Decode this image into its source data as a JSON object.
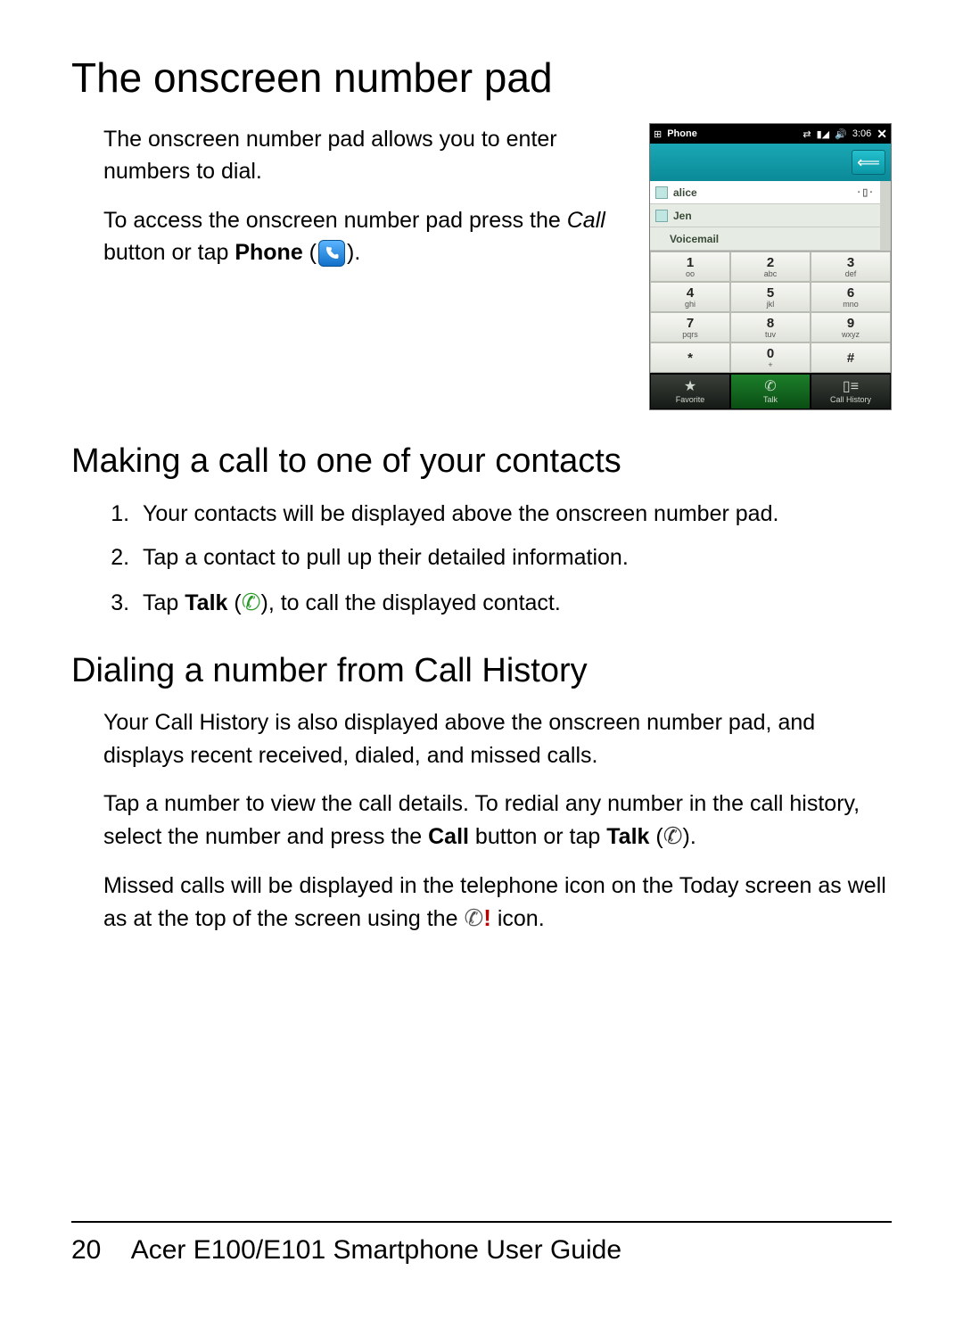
{
  "page": {
    "title": "The onscreen number pad",
    "intro1": "The onscreen number pad allows you to enter numbers to dial.",
    "intro2a": "To access the onscreen number pad press the ",
    "intro2b": "Call",
    "intro2c": " button or tap ",
    "intro2d": "Phone",
    "intro2e": " (",
    "intro2f": ")."
  },
  "section2": {
    "title": "Making a call to one of your contacts",
    "items": [
      "Your contacts will be displayed above the onscreen number pad.",
      "Tap a contact to pull up their detailed information."
    ],
    "item3a": "Tap ",
    "item3b": "Talk",
    "item3c": " (",
    "item3d": "), to call the displayed contact."
  },
  "section3": {
    "title": "Dialing a number from Call History",
    "p1": "Your Call History is also displayed above the onscreen number pad, and displays recent received, dialed, and missed calls.",
    "p2a": "Tap a number to view the call details. To redial any number in the call history, select the number and press the ",
    "p2b": "Call",
    "p2c": " button or tap ",
    "p2d": "Talk",
    "p2e": " (",
    "p2f": ").",
    "p3a": "Missed calls will be displayed in the telephone icon on the Today screen as well as at the top of the screen using the ",
    "p3b": " icon."
  },
  "footer": {
    "page": "20",
    "title": "Acer E100/E101 Smartphone User Guide"
  },
  "phone": {
    "status": {
      "app": "Phone",
      "time": "3:06"
    },
    "contacts": [
      "alice",
      "Jen",
      "Voicemail"
    ],
    "keypad": [
      {
        "n": "1",
        "s": "oo"
      },
      {
        "n": "2",
        "s": "abc"
      },
      {
        "n": "3",
        "s": "def"
      },
      {
        "n": "4",
        "s": "ghi"
      },
      {
        "n": "5",
        "s": "jkl"
      },
      {
        "n": "6",
        "s": "mno"
      },
      {
        "n": "7",
        "s": "pqrs"
      },
      {
        "n": "8",
        "s": "tuv"
      },
      {
        "n": "9",
        "s": "wxyz"
      },
      {
        "n": "*",
        "s": ""
      },
      {
        "n": "0",
        "s": "+"
      },
      {
        "n": "#",
        "s": ""
      }
    ],
    "bottom": [
      {
        "label": "Favorite",
        "icon": "★"
      },
      {
        "label": "Talk",
        "icon": "✆"
      },
      {
        "label": "Call History",
        "icon": "▯≡"
      }
    ]
  }
}
